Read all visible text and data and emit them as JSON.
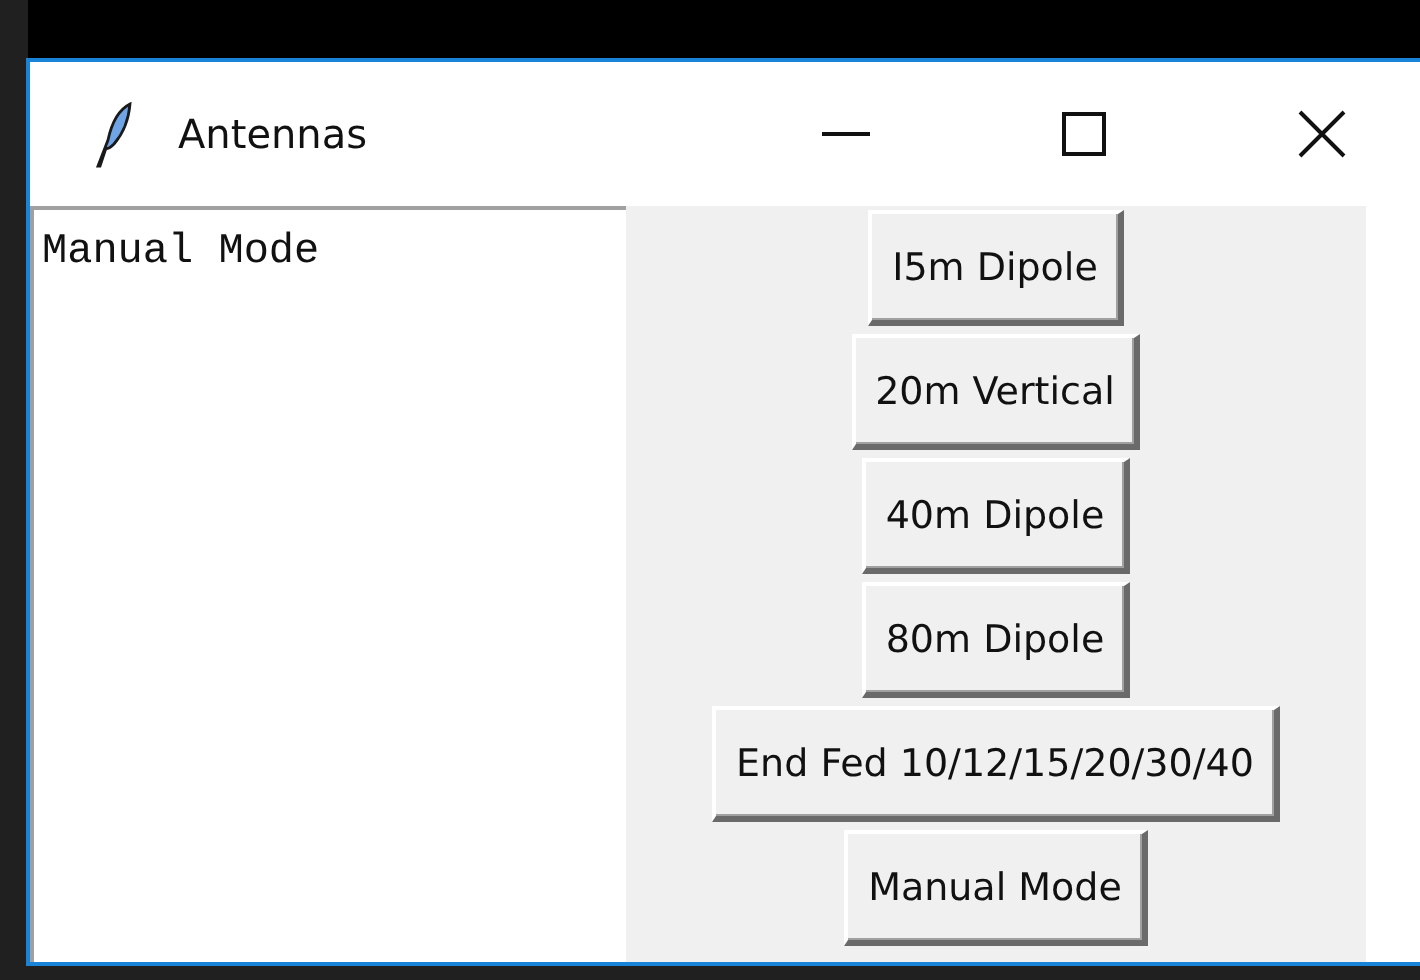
{
  "window": {
    "title": "Antennas"
  },
  "text_area": {
    "value": "Manual Mode"
  },
  "buttons": [
    "I5m Dipole",
    "20m Vertical",
    "40m Dipole",
    "80m Dipole",
    "End Fed 10/12/15/20/30/40",
    "Manual Mode"
  ]
}
